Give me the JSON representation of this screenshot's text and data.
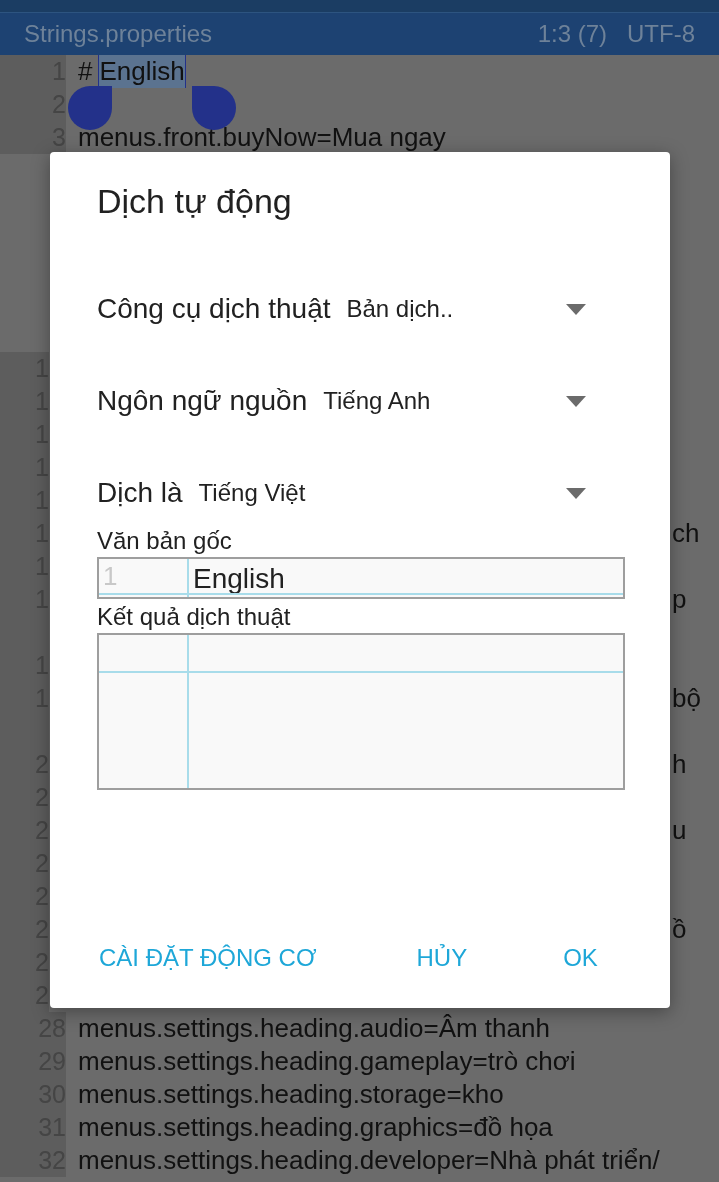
{
  "editor": {
    "file_name": "Strings.properties",
    "cursor": "1:3 (7)",
    "encoding": "UTF-8",
    "top_lines": [
      {
        "number": "1",
        "text": "#",
        "selection": "English"
      },
      {
        "number": "2"
      },
      {
        "number": "3",
        "text": "menus.front.buyNow=Mua ngay"
      }
    ],
    "lower_lines": [
      {
        "number": "1"
      },
      {
        "number": "1"
      },
      {
        "number": "1"
      },
      {
        "number": "1"
      },
      {
        "number": "1"
      },
      {
        "number": "1",
        "tail": "ch"
      },
      {
        "number": "1"
      },
      {
        "number": "1",
        "tail": "p",
        "wraps": true
      },
      {
        "number": "1"
      },
      {
        "number": "1",
        "tail": "bộ",
        "wraps": true
      },
      {
        "number": "2",
        "tail": "h"
      },
      {
        "number": "2"
      },
      {
        "number": "2",
        "tail": "u"
      },
      {
        "number": "2"
      },
      {
        "number": "2"
      },
      {
        "number": "2",
        "tail": "ồ"
      },
      {
        "number": "2"
      },
      {
        "number": "2"
      },
      {
        "number": "28",
        "text": "menus.settings.heading.audio=Âm thanh"
      },
      {
        "number": "29",
        "text": "menus.settings.heading.gameplay=trò chơi"
      },
      {
        "number": "30",
        "text": "menus.settings.heading.storage=kho"
      },
      {
        "number": "31",
        "text": "menus.settings.heading.graphics=đồ họa"
      },
      {
        "number": "32",
        "text": "menus.settings.heading.developer=Nhà phát triển/"
      }
    ]
  },
  "dialog": {
    "title": "Dịch tự động",
    "options": [
      {
        "label": "Công cụ dịch thuật",
        "value": "Bản dịch.."
      },
      {
        "label": "Ngôn ngữ nguồn",
        "value": "Tiếng Anh"
      },
      {
        "label": "Dịch là",
        "value": "Tiếng Việt"
      }
    ],
    "source": {
      "label": "Văn bản gốc",
      "line_number": "1",
      "value": "English"
    },
    "result": {
      "label": "Kết quả dịch thuật"
    },
    "buttons": [
      "CÀI ĐẶT ĐỘNG CƠ",
      "HỦY",
      "OK"
    ]
  }
}
